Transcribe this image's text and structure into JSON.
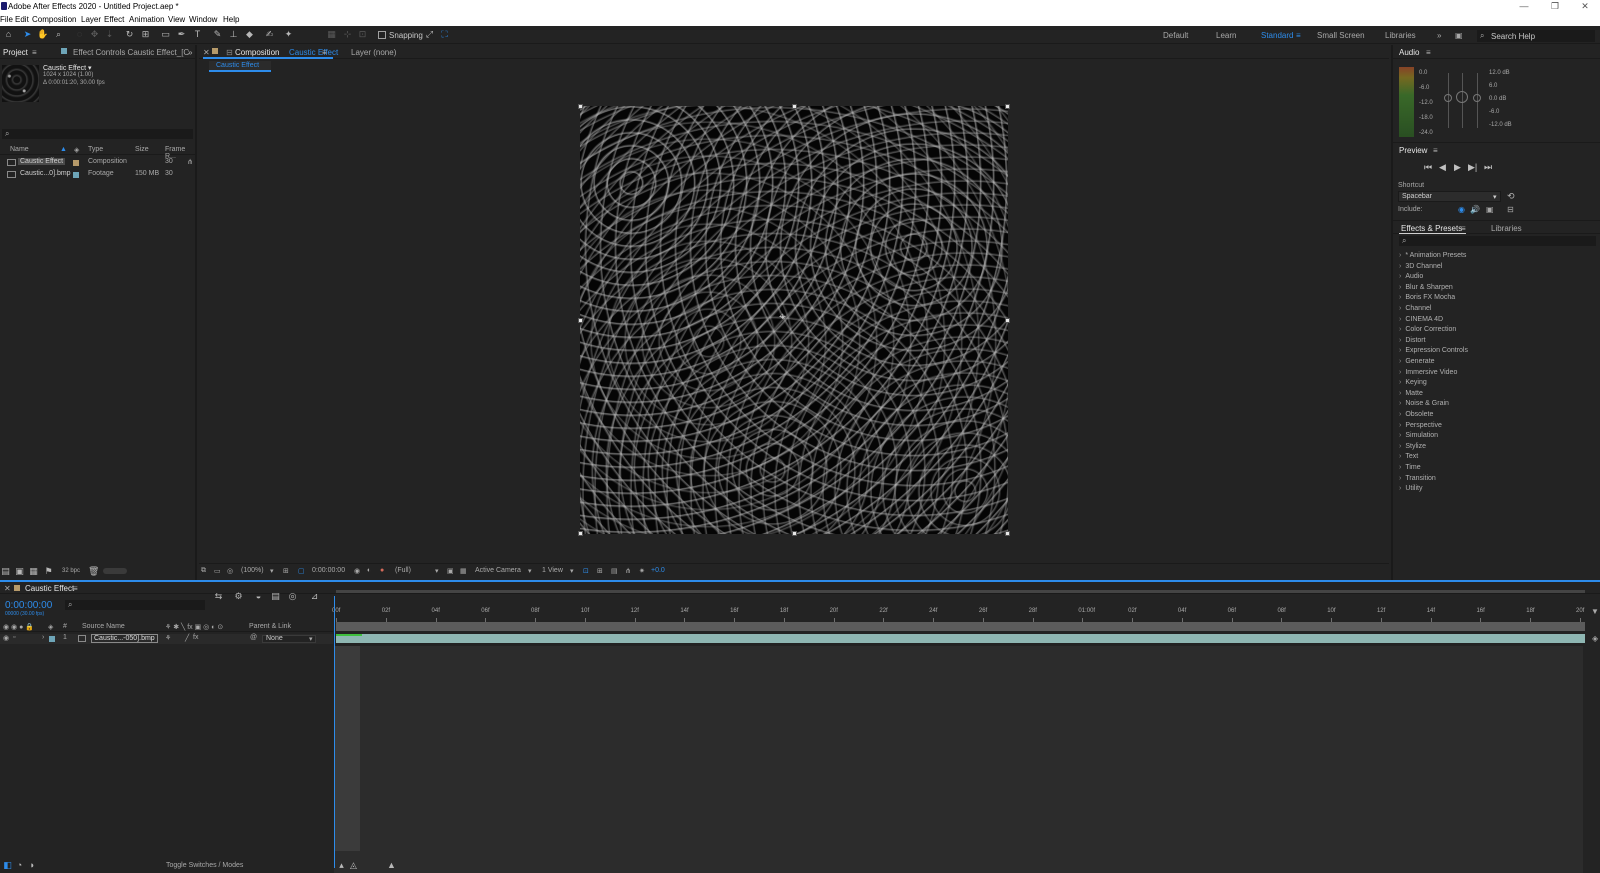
{
  "titlebar": {
    "title": "Adobe After Effects 2020 - Untitled Project.aep *",
    "min": "—",
    "max": "❐",
    "close": "✕"
  },
  "menu": [
    "File",
    "Edit",
    "Composition",
    "Layer",
    "Effect",
    "Animation",
    "View",
    "Window",
    "Help"
  ],
  "toolbar": {
    "snapping_label": "Snapping",
    "workspaces": [
      "Default",
      "Learn",
      "Standard",
      "Small Screen",
      "Libraries"
    ],
    "active_workspace": "Standard",
    "search_placeholder": "Search Help"
  },
  "project": {
    "tab": "Project",
    "effect_controls_tab": "Effect Controls  Caustic Effect_[C",
    "comp_name": "Caustic Effect ▾",
    "comp_dims": "1024 x 1024 (1.00)",
    "comp_duration": "Δ 0:00:01:20, 30.00 fps",
    "columns": {
      "name": "Name",
      "type": "Type",
      "size": "Size",
      "frame": "Frame R..."
    },
    "items": [
      {
        "name": "Caustic Effect",
        "type": "Composition",
        "size": "",
        "frame": "30"
      },
      {
        "name": "Caustic...0].bmp",
        "type": "Footage",
        "size": "150 MB",
        "frame": "30"
      }
    ],
    "bpc": "32 bpc"
  },
  "composition": {
    "tab_prefix": "Composition",
    "tab_name": "Caustic Effect",
    "layer_tab": "Layer  (none)",
    "subtab": "Caustic Effect",
    "footer": {
      "zoom": "(100%)",
      "timecode": "0:00:00:00",
      "resolution": "(Full)",
      "camera": "Active Camera",
      "views": "1 View",
      "exposure": "+0.0"
    }
  },
  "audio": {
    "tab": "Audio",
    "left_db": [
      "0.0",
      "-6.0",
      "-12.0",
      "-18.0",
      "-24.0"
    ],
    "right_db": [
      "12.0 dB",
      "6.0",
      "0.0 dB",
      "-6.0",
      "-12.0 dB"
    ]
  },
  "preview": {
    "tab": "Preview",
    "shortcut_label": "Shortcut",
    "shortcut_value": "Spacebar",
    "include_label": "Include:"
  },
  "effects": {
    "tab": "Effects & Presets",
    "libraries_tab": "Libraries",
    "items": [
      "* Animation Presets",
      "3D Channel",
      "Audio",
      "Blur & Sharpen",
      "Boris FX Mocha",
      "Channel",
      "CINEMA 4D",
      "Color Correction",
      "Distort",
      "Expression Controls",
      "Generate",
      "Immersive Video",
      "Keying",
      "Matte",
      "Noise & Grain",
      "Obsolete",
      "Perspective",
      "Simulation",
      "Stylize",
      "Text",
      "Time",
      "Transition",
      "Utility"
    ]
  },
  "timeline": {
    "tab": "Caustic Effect",
    "timecode": "0:00:00:00",
    "frames": "00000 (30.00 fps)",
    "cols": {
      "num": "#",
      "source": "Source Name",
      "parent": "Parent & Link"
    },
    "layer": {
      "index": "1",
      "name": "Caustic...-050].bmp",
      "parent": "None"
    },
    "ruler": [
      "00f",
      "02f",
      "04f",
      "06f",
      "08f",
      "10f",
      "12f",
      "14f",
      "16f",
      "18f",
      "20f",
      "22f",
      "24f",
      "26f",
      "28f",
      "01:00f",
      "02f",
      "04f",
      "06f",
      "08f",
      "10f",
      "12f",
      "14f",
      "16f",
      "18f",
      "20f"
    ],
    "footer": "Toggle Switches / Modes"
  }
}
